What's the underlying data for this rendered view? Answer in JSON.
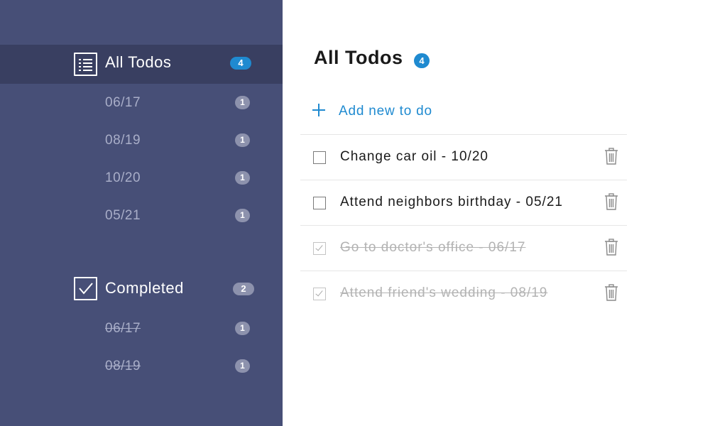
{
  "sidebar": {
    "groups": [
      {
        "label": "All Todos",
        "icon": "list-icon",
        "count": "4",
        "badge_color": "#1f8ad0",
        "items": [
          {
            "label": "06/17",
            "count": "1"
          },
          {
            "label": "08/19",
            "count": "1"
          },
          {
            "label": "10/20",
            "count": "1"
          },
          {
            "label": "05/21",
            "count": "1"
          }
        ]
      },
      {
        "label": "Completed",
        "icon": "checkbox-checked-icon",
        "count": "2",
        "badge_color": "#8d92ad",
        "items": [
          {
            "label": "06/17",
            "count": "1"
          },
          {
            "label": "08/19",
            "count": "1"
          }
        ]
      }
    ]
  },
  "main": {
    "title": "All Todos",
    "count": "4",
    "add_label": "Add new to do",
    "todos": [
      {
        "text": "Change car oil - 10/20",
        "completed": false
      },
      {
        "text": "Attend neighbors birthday - 05/21",
        "completed": false
      },
      {
        "text": "Go to doctor's office - 06/17",
        "completed": true
      },
      {
        "text": "Attend friend's wedding - 08/19",
        "completed": true
      }
    ]
  },
  "colors": {
    "sidebar_bg": "#474f77",
    "sidebar_active_bg": "#393f61",
    "accent": "#1f8ad0"
  }
}
